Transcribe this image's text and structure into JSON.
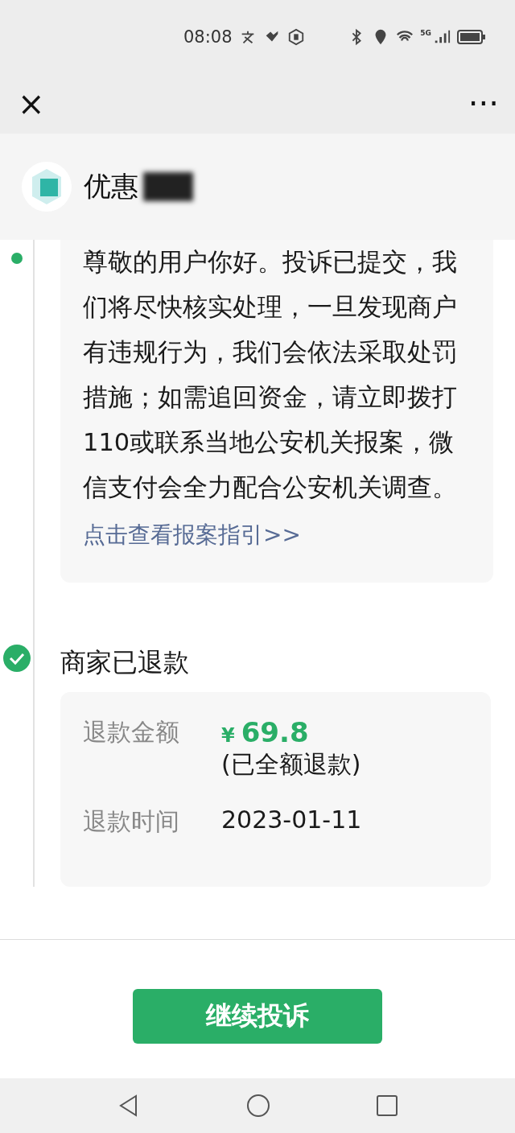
{
  "status_bar": {
    "time": "08:08",
    "network": "5G"
  },
  "nav": {
    "close": "×",
    "more": "···"
  },
  "header": {
    "title": "优惠",
    "redacted": true
  },
  "timeline": [
    {
      "kind": "message",
      "done": false,
      "text": "尊敬的用户你好。投诉已提交，我们将尽快核实处理，一旦发现商户有违规行为，我们会依法采取处罚措施；如需追回资金，请立即拨打110或联系当地公安机关报案，微信支付会全力配合公安机关调查。",
      "link": "点击查看报案指引>>"
    },
    {
      "kind": "refund",
      "done": true,
      "title": "商家已退款",
      "rows": [
        {
          "label": "退款金额",
          "currency": "¥",
          "amount": "69.8",
          "note": "(已全额退款)"
        },
        {
          "label": "退款时间",
          "value": "2023-01-11"
        }
      ]
    }
  ],
  "button": "继续投诉"
}
